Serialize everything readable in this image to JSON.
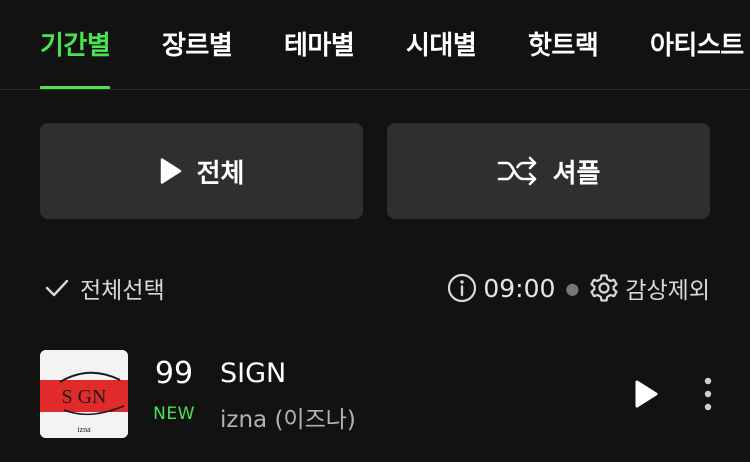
{
  "tabs": [
    {
      "label": "기간별",
      "active": true
    },
    {
      "label": "장르별",
      "active": false
    },
    {
      "label": "테마별",
      "active": false
    },
    {
      "label": "시대별",
      "active": false
    },
    {
      "label": "핫트랙",
      "active": false
    },
    {
      "label": "아티스트",
      "active": false
    }
  ],
  "actions": {
    "play_all_label": "전체",
    "shuffle_label": "셔플"
  },
  "list_header": {
    "select_all_label": "전체선택",
    "time_value": "09:00",
    "exclude_label": "감상제외"
  },
  "tracks": [
    {
      "rank": "99",
      "badge": "NEW",
      "title": "SIGN",
      "artist": "izna (이즈나)",
      "cover_text": "S GN",
      "cover_sub": "izna"
    }
  ],
  "colors": {
    "accent": "#4ae350",
    "background": "#121212",
    "button_bg": "#2f2f2f"
  }
}
